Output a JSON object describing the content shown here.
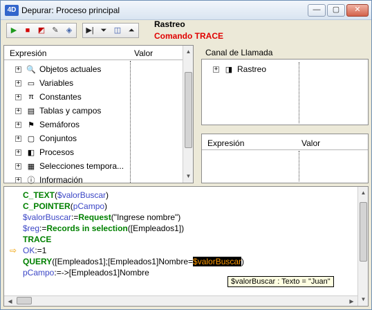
{
  "window": {
    "title": "Depurar: Proceso principal",
    "icon_text": "4D",
    "minimize": "—",
    "maximize": "▢",
    "close": "✕"
  },
  "toolbar": {
    "buttons": [
      {
        "name": "run-icon",
        "glyph": "▶",
        "color": "#1f9a1f"
      },
      {
        "name": "stop-icon",
        "glyph": "■",
        "color": "#d40000"
      },
      {
        "name": "abort-icon",
        "glyph": "◩",
        "color": "#c00000"
      },
      {
        "name": "edit-icon",
        "glyph": "✎",
        "color": "#444"
      },
      {
        "name": "no-trace-icon",
        "glyph": "◈",
        "color": "#4466aa"
      },
      {
        "name": "step-over-icon",
        "glyph": "▶|",
        "color": "#222"
      },
      {
        "name": "step-into-icon",
        "glyph": "⏷",
        "color": "#222"
      },
      {
        "name": "step-into-process-icon",
        "glyph": "◫",
        "color": "#3355aa"
      },
      {
        "name": "step-out-icon",
        "glyph": "⏶",
        "color": "#222"
      }
    ],
    "trace_title": "Rastreo",
    "trace_subtitle": "Comando TRACE"
  },
  "expression_pane": {
    "col_expression": "Expresión",
    "col_value": "Valor",
    "items": [
      {
        "label": "Objetos actuales",
        "icon": "magnifier-icon"
      },
      {
        "label": "Variables",
        "icon": "variables-icon"
      },
      {
        "label": "Constantes",
        "icon": "pi-icon"
      },
      {
        "label": "Tablas y campos",
        "icon": "table-icon"
      },
      {
        "label": "Semáforos",
        "icon": "semaphore-icon"
      },
      {
        "label": "Conjuntos",
        "icon": "sets-icon"
      },
      {
        "label": "Procesos",
        "icon": "process-icon"
      },
      {
        "label": "Selecciones tempora...",
        "icon": "selection-icon"
      },
      {
        "label": "Información",
        "icon": "info-icon"
      }
    ]
  },
  "call_chain": {
    "title": "Canal de Llamada",
    "items": [
      {
        "label": "Rastreo",
        "icon": "method-icon"
      }
    ]
  },
  "custom_watch": {
    "col_expression": "Expresión",
    "col_value": "Valor"
  },
  "code": {
    "lines": [
      [
        {
          "t": "C_TEXT",
          "c": "k"
        },
        {
          "t": "(",
          "c": "s"
        },
        {
          "t": "$valorBuscar",
          "c": "v"
        },
        {
          "t": ")",
          "c": "s"
        }
      ],
      [
        {
          "t": "C_POINTER",
          "c": "k"
        },
        {
          "t": "(",
          "c": "s"
        },
        {
          "t": "pCampo",
          "c": "v"
        },
        {
          "t": ")",
          "c": "s"
        }
      ],
      [
        {
          "t": "$valorBuscar",
          "c": "v"
        },
        {
          "t": ":=",
          "c": "s"
        },
        {
          "t": "Request",
          "c": "k"
        },
        {
          "t": "(\"Ingrese nombre\")",
          "c": "s"
        }
      ],
      [
        {
          "t": "$reg",
          "c": "v"
        },
        {
          "t": ":=",
          "c": "s"
        },
        {
          "t": "Records in selection",
          "c": "k"
        },
        {
          "t": "([Empleados1])",
          "c": "s"
        }
      ],
      [
        {
          "t": "TRACE",
          "c": "k"
        }
      ],
      [
        {
          "t": "OK",
          "c": "v"
        },
        {
          "t": ":=1",
          "c": "s"
        }
      ],
      [
        {
          "t": "QUERY",
          "c": "k"
        },
        {
          "t": "([Empleados1];[Empleados1]Nombre=",
          "c": "s"
        },
        {
          "t": "$valorBuscar",
          "c": "hl"
        },
        {
          "t": ")",
          "c": "s"
        }
      ],
      [
        {
          "t": "pCampo",
          "c": "v"
        },
        {
          "t": ":=->[Empleados1]Nombre",
          "c": "s"
        }
      ]
    ],
    "current_line": 6,
    "tooltip": "$valorBuscar : Texto = \"Juan\""
  }
}
